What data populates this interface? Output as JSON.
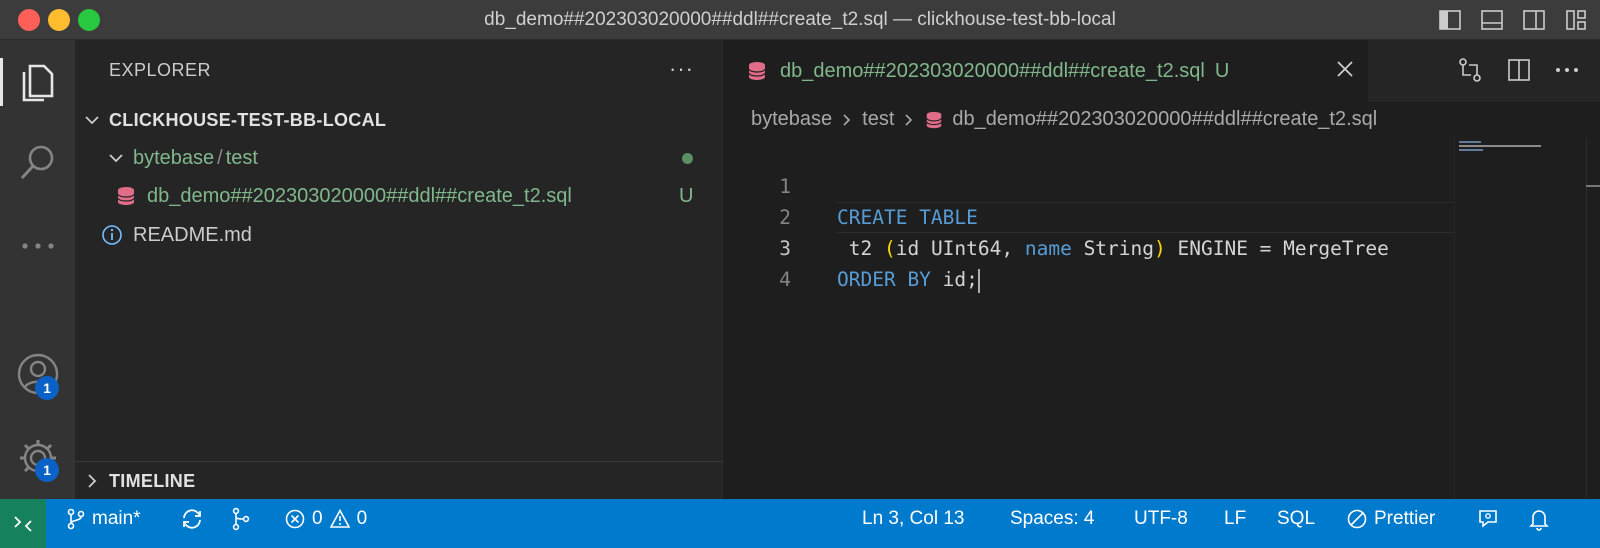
{
  "window": {
    "title": "db_demo##20230302000​0##ddl##create_t2.sql — clickhouse-test-bb-local"
  },
  "activity_bar": {
    "accounts_badge": "1",
    "manage_badge": "1"
  },
  "explorer": {
    "header": "EXPLORER",
    "more": "···",
    "folder": "CLICKHOUSE-TEST-BB-LOCAL",
    "path_part1": "bytebase",
    "path_sep": "/",
    "path_part2": "test",
    "file_sql": "db_demo##20230302000​0##ddl##create_t2.sql",
    "file_sql_status": "U",
    "file_readme": "README.md",
    "timeline": "TIMELINE"
  },
  "editor": {
    "tab_label": "db_demo##20230302000​0##ddl##create_t2.sql",
    "tab_status": "U",
    "breadcrumb": {
      "part1": "bytebase",
      "part2": "test",
      "file": "db_demo##20230302000​0##ddl##create_t2.sql"
    },
    "lines": {
      "n1": "1",
      "n2": "2",
      "n3": "3",
      "n4": "4",
      "l1_kw": "CREATE TABLE",
      "l2_a": " t2 ",
      "l2_open": "(",
      "l2_b": "id UInt64, ",
      "l2_name": "name",
      "l2_c": " String",
      "l2_close": ")",
      "l2_d": " ENGINE = MergeTree",
      "l3_kw": "ORDER BY",
      "l3_rest": " id;"
    }
  },
  "status_bar": {
    "branch": "main*",
    "errors": "0",
    "warnings": "0",
    "position": "Ln 3, Col 13",
    "spaces": "Spaces: 4",
    "encoding": "UTF-8",
    "eol": "LF",
    "language": "SQL",
    "formatter": "Prettier"
  },
  "colors": {
    "status_bar": "#007acc",
    "remote": "#16825d",
    "git_untracked": "#81b88b",
    "keyword": "#569cd6",
    "bracket": "#ffd700",
    "db_icon": "#e06c88"
  }
}
